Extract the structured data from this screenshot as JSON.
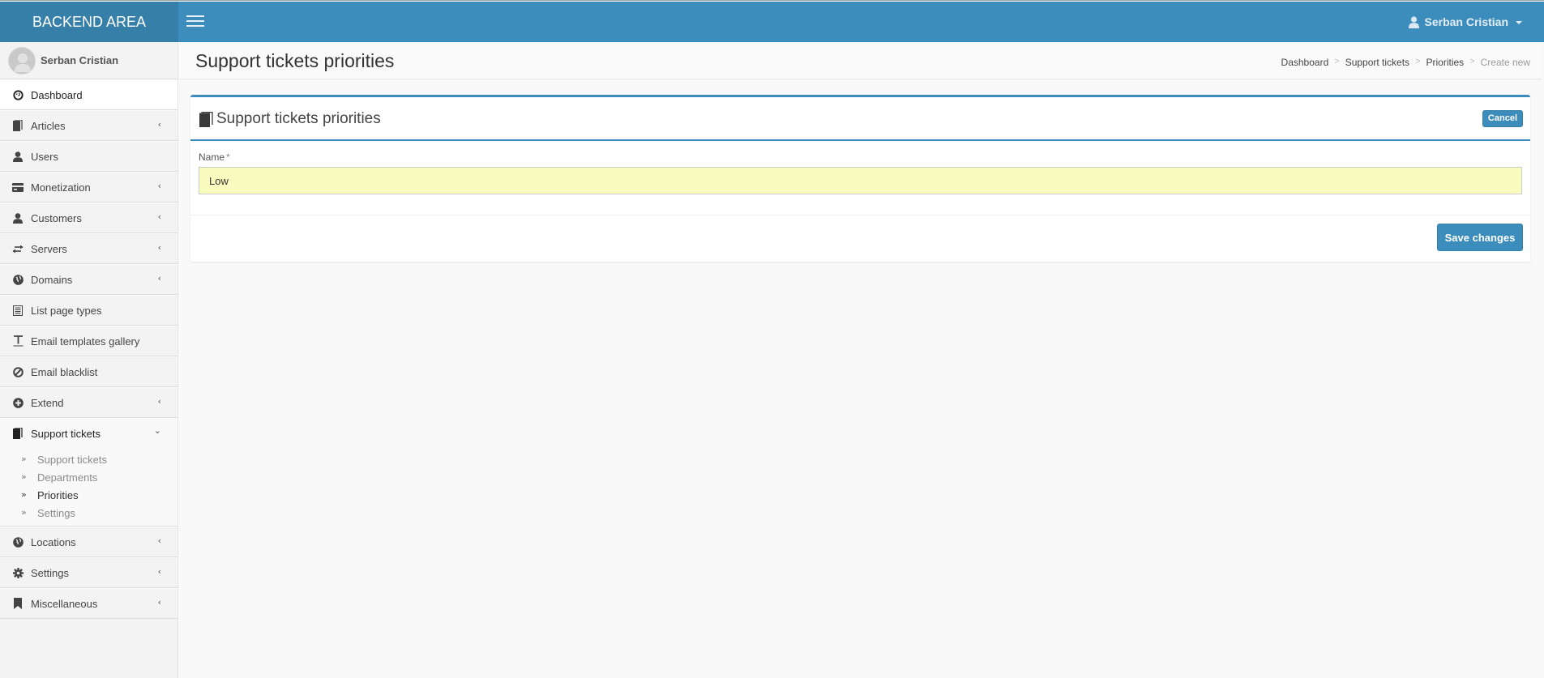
{
  "app": {
    "brand": "BACKEND AREA",
    "user_name": "Serban Cristian"
  },
  "sidebar": {
    "user_name": "Serban Cristian",
    "items": [
      {
        "label": "Dashboard",
        "icon": "dashboard-icon",
        "has_children": false,
        "active": true
      },
      {
        "label": "Articles",
        "icon": "book-icon",
        "has_children": true
      },
      {
        "label": "Users",
        "icon": "user-icon",
        "has_children": false
      },
      {
        "label": "Monetization",
        "icon": "credit-card-icon",
        "has_children": true
      },
      {
        "label": "Customers",
        "icon": "user-icon",
        "has_children": true
      },
      {
        "label": "Servers",
        "icon": "transfer-icon",
        "has_children": true
      },
      {
        "label": "Domains",
        "icon": "globe-icon",
        "has_children": true
      },
      {
        "label": "List page types",
        "icon": "list-alt-icon",
        "has_children": false
      },
      {
        "label": "Email templates gallery",
        "icon": "text-width-icon",
        "has_children": false
      },
      {
        "label": "Email blacklist",
        "icon": "ban-icon",
        "has_children": false
      },
      {
        "label": "Extend",
        "icon": "plus-circle-icon",
        "has_children": true
      },
      {
        "label": "Support tickets",
        "icon": "book-icon",
        "has_children": true,
        "expanded": true
      },
      {
        "label": "Locations",
        "icon": "globe-icon",
        "has_children": true
      },
      {
        "label": "Settings",
        "icon": "cog-icon",
        "has_children": true
      },
      {
        "label": "Miscellaneous",
        "icon": "bookmark-icon",
        "has_children": true
      }
    ],
    "support_submenu": [
      {
        "label": "Support tickets",
        "active": false
      },
      {
        "label": "Departments",
        "active": false
      },
      {
        "label": "Priorities",
        "active": true
      },
      {
        "label": "Settings",
        "active": false
      }
    ],
    "collapsed_chevron": "‹",
    "expanded_chevron": "⌄",
    "submenu_bullet": "»"
  },
  "header": {
    "title": "Support tickets priorities",
    "breadcrumb": [
      "Dashboard",
      "Support tickets",
      "Priorities",
      "Create new"
    ],
    "breadcrumb_separator": ">"
  },
  "box": {
    "title": "Support tickets priorities",
    "cancel_label": "Cancel",
    "field": {
      "label": "Name",
      "required_mark": "*",
      "value": "Low"
    },
    "save_label": "Save changes"
  },
  "colors": {
    "primary": "#3c8dbc",
    "logo_bg": "#367fa9",
    "input_highlight": "#f8fcbe"
  }
}
